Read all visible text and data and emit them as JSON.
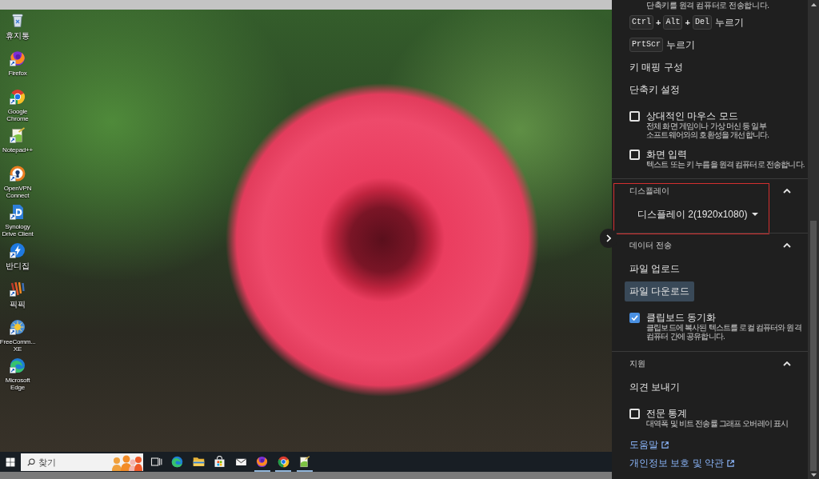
{
  "remote_desktop": {
    "desktop_icons": [
      {
        "kind": "trash",
        "label": "휴지통",
        "shortcut": false
      },
      {
        "kind": "firefox",
        "label": "Firefox",
        "shortcut": true
      },
      {
        "kind": "chrome",
        "label": "Google Chrome",
        "shortcut": true
      },
      {
        "kind": "notepad",
        "label": "Notepad++",
        "shortcut": true
      },
      {
        "kind": "openvpn",
        "label": "OpenVPN Connect",
        "shortcut": true
      },
      {
        "kind": "synology",
        "label": "Synology Drive Client",
        "shortcut": true
      },
      {
        "kind": "bandizip",
        "label": "반디집",
        "shortcut": true
      },
      {
        "kind": "picpick",
        "label": "픽픽",
        "shortcut": true
      },
      {
        "kind": "freecommander",
        "label": "FreeComm... XE",
        "shortcut": true
      },
      {
        "kind": "edge",
        "label": "Microsoft Edge",
        "shortcut": true
      }
    ],
    "taskbar": {
      "search": {
        "placeholder": "찾기"
      },
      "apps": [
        {
          "kind": "task_view",
          "running": false
        },
        {
          "kind": "edge",
          "running": false
        },
        {
          "kind": "files",
          "running": false
        },
        {
          "kind": "store",
          "running": false
        },
        {
          "kind": "mail",
          "running": false
        },
        {
          "kind": "firefox",
          "running": true
        },
        {
          "kind": "chrome",
          "running": true
        },
        {
          "kind": "notepad",
          "running": true
        }
      ]
    }
  },
  "side_panel": {
    "sections": [
      {
        "annotated": false,
        "items": [
          {
            "kind": "note",
            "text": "단축키를 원격 컴퓨터로 전송합니다."
          },
          {
            "kind": "keys",
            "parts": [
              {
                "kind": "key",
                "text": "Ctrl"
              },
              {
                "kind": "plus",
                "text": "+"
              },
              {
                "kind": "key",
                "text": "Alt"
              },
              {
                "kind": "plus",
                "text": "+"
              },
              {
                "kind": "key",
                "text": "Del"
              },
              {
                "kind": "word",
                "text": "누르기"
              }
            ]
          },
          {
            "kind": "keys",
            "parts": [
              {
                "kind": "key",
                "text": "PrtScr"
              },
              {
                "kind": "word",
                "text": "누르기"
              }
            ]
          },
          {
            "kind": "action",
            "label": "키 매핑 구성",
            "focused": false
          },
          {
            "kind": "action",
            "label": "단축키 설정",
            "focused": false
          },
          {
            "kind": "checkbox",
            "label": "상대적인 마우스 모드",
            "description": "전체 화면 게임이나 가상 머신 등 일부 소프트웨어와의 호환성을 개선합니다.",
            "checked": false
          },
          {
            "kind": "checkbox",
            "label": "화면 입력",
            "description": "텍스트 또는 키 누름을 원격 컴퓨터로 전송합니다.",
            "checked": false
          }
        ]
      },
      {
        "title": "디스플레이",
        "expanded": true,
        "annotated": true,
        "items": [
          {
            "kind": "dropdown",
            "value": "디스플레이 2(1920x1080)"
          }
        ]
      },
      {
        "title": "데이터 전송",
        "expanded": true,
        "annotated": false,
        "items": [
          {
            "kind": "action",
            "label": "파일 업로드",
            "focused": false
          },
          {
            "kind": "action",
            "label": "파일 다운로드",
            "focused": true
          },
          {
            "kind": "checkbox",
            "label": "클립보드 동기화",
            "description": "클립보드에 복사된 텍스트를 로컬 컴퓨터와 원격 컴퓨터 간에 공유합니다.",
            "checked": true
          }
        ]
      },
      {
        "title": "지원",
        "expanded": true,
        "annotated": false,
        "items": [
          {
            "kind": "action",
            "label": "의견 보내기",
            "focused": false
          },
          {
            "kind": "checkbox",
            "label": "전문 통계",
            "description": "대역폭 및 비트 전송률 그래프 오버레이 표시",
            "checked": false
          },
          {
            "kind": "link",
            "label": "도움말"
          },
          {
            "kind": "link",
            "label": "개인정보 보호 및 약관"
          }
        ]
      }
    ]
  }
}
